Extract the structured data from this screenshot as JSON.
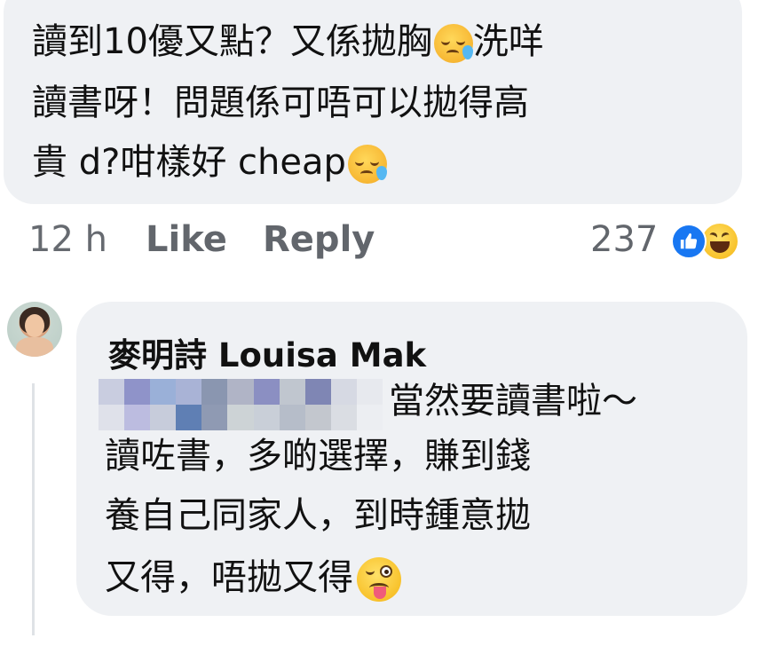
{
  "comment": {
    "lines": [
      {
        "text": "讀到10優又點？又係拋胸",
        "after": "洗咩"
      },
      {
        "text": "讀書呀！問題係可唔可以拋得高"
      },
      {
        "text": "貴 d?咁樣好 cheap"
      }
    ],
    "emoji_sleepy": "sleepy-face-icon"
  },
  "meta": {
    "time": "12 h",
    "like_label": "Like",
    "reply_label": "Reply",
    "reaction_count": "237",
    "reactions": [
      "like-reaction-icon",
      "haha-reaction-icon"
    ]
  },
  "reply": {
    "author": "麥明詩 Louisa Mak",
    "lines": [
      "當然要讀書啦～",
      "讀咗書，多啲選擇，賺到錢",
      "養自己同家人，到時鍾意拋",
      "又得，唔拋又得"
    ],
    "emoji_wink": "winking-face-with-tongue-icon"
  },
  "colors": {
    "bubble": "#eff1f4",
    "meta_text": "#62666c",
    "like_blue": "#1877f2",
    "thread_line": "#dfe2e6"
  },
  "redaction_palette": [
    "#c9cde0",
    "#8f93c9",
    "#9ab0d8",
    "#a9b3d6",
    "#8a96b0",
    "#b0b4c6",
    "#8b8fc2",
    "#c0c6cf",
    "#7f86b4",
    "#d6d9e3",
    "#e7e9ee",
    "#dfe1ea",
    "#bcbce0",
    "#c7ccdb",
    "#5f7fb4",
    "#8f9ab3",
    "#cdd3d6",
    "#c9cfd8",
    "#b6bdc9",
    "#c3c7ce",
    "#dadde3",
    "#eceef2"
  ]
}
